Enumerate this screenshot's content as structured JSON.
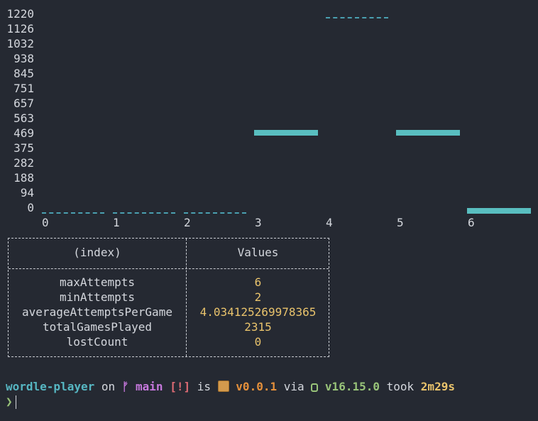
{
  "chart_data": {
    "type": "bar",
    "x_ticks": [
      "0",
      "1",
      "2",
      "3",
      "4",
      "5",
      "6"
    ],
    "y_ticks": [
      "1220",
      "1126",
      "1032",
      "938",
      "845",
      "751",
      "657",
      "563",
      "469",
      "375",
      "282",
      "188",
      "94",
      "0"
    ],
    "ylim": [
      0,
      1220
    ],
    "categories": [
      "0",
      "1",
      "2",
      "3",
      "4",
      "5",
      "6"
    ],
    "values": [
      0,
      0,
      0,
      469,
      1220,
      469,
      0
    ],
    "render": [
      "dashed",
      "dashed",
      "dashed",
      "solid",
      "dashed",
      "solid",
      "solid"
    ],
    "colors": {
      "bar": "#59bec0",
      "dashed": "#4a9fb0"
    }
  },
  "table": {
    "headers": [
      "(index)",
      "Values"
    ],
    "rows": [
      {
        "index": "maxAttempts",
        "value": "6"
      },
      {
        "index": "minAttempts",
        "value": "2"
      },
      {
        "index": "averageAttemptsPerGame",
        "value": "4.034125269978365"
      },
      {
        "index": "totalGamesPlayed",
        "value": "2315"
      },
      {
        "index": "lostCount",
        "value": "0"
      }
    ]
  },
  "prompt": {
    "dir": "wordle-player",
    "on": "on",
    "branch_icon": "",
    "branch": "main",
    "status": "[!]",
    "is": "is",
    "pkg_icon": "package-icon",
    "pkg_version": "v0.0.1",
    "via": "via",
    "node_icon": "nodejs-icon",
    "node_version": "v16.15.0",
    "took": "took",
    "duration": "2m29s",
    "symbol": "❯"
  }
}
